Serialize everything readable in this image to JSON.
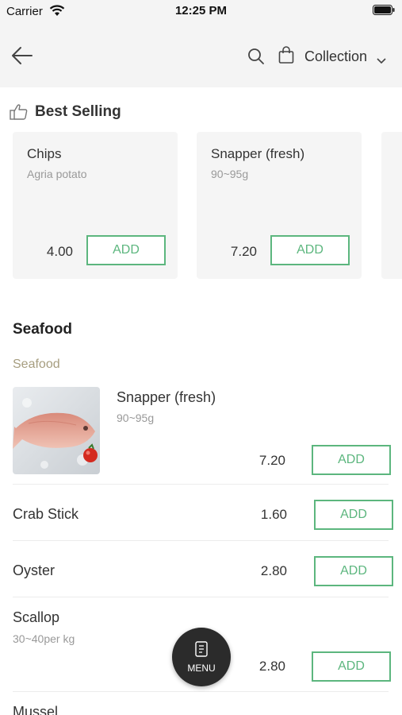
{
  "status_bar": {
    "carrier": "Carrier",
    "time": "12:25 PM"
  },
  "nav": {
    "collection_label": "Collection"
  },
  "best_selling": {
    "title": "Best Selling",
    "items": [
      {
        "name": "Chips",
        "subtitle": "Agria potato",
        "price": "4.00",
        "add_label": "ADD"
      },
      {
        "name": "Snapper (fresh)",
        "subtitle": "90~95g",
        "price": "7.20",
        "add_label": "ADD"
      }
    ]
  },
  "section": {
    "title": "Seafood",
    "subcategory": "Seafood",
    "items": [
      {
        "name": "Snapper (fresh)",
        "subtitle": "90~95g",
        "price": "7.20",
        "add_label": "ADD"
      },
      {
        "name": "Crab Stick",
        "price": "1.60",
        "add_label": "ADD"
      },
      {
        "name": "Oyster",
        "price": "2.80",
        "add_label": "ADD"
      },
      {
        "name": "Scallop",
        "subtitle": "30~40per kg",
        "price": "2.80",
        "add_label": "ADD"
      },
      {
        "name": "Mussel"
      }
    ]
  },
  "menu_fab": {
    "label": "MENU"
  },
  "colors": {
    "accent": "#5cb67e",
    "subcategory": "#a69d7f",
    "header_bg": "#f4f4f4",
    "fab": "#2b2b2b"
  }
}
